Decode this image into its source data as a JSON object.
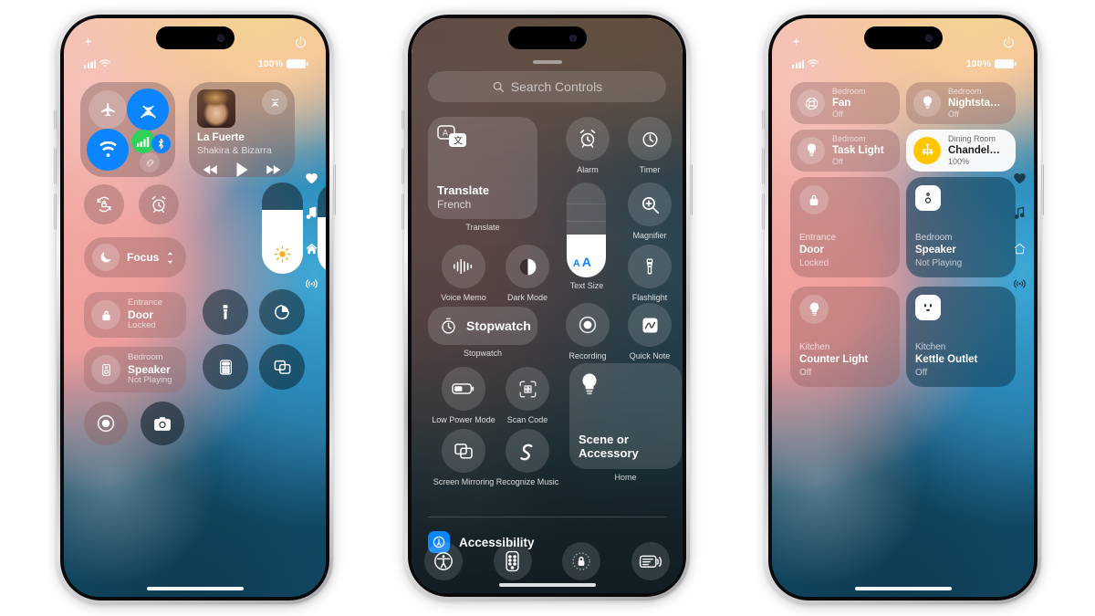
{
  "scene": {
    "title": "iOS 18 Control Center — three iPhone screens",
    "background": "#ffffff",
    "accent_blue": "#0a84ff",
    "accent_green": "#30d158",
    "accent_yellow": "#ffc600"
  },
  "phone1": {
    "status": {
      "battery_percent": "100%",
      "sparkle_icon": "sparkle-icon",
      "power_icon": "power-icon",
      "cellular_icon": "cellular-bars-icon",
      "wifi_icon": "wifi-icon",
      "battery_icon": "battery-icon"
    },
    "connectivity": {
      "airplane": {
        "label": "Airplane Mode",
        "icon": "airplane-icon",
        "state": "off"
      },
      "airdrop": {
        "label": "AirDrop",
        "icon": "airdrop-icon",
        "state": "on"
      },
      "wifi": {
        "label": "Wi-Fi",
        "icon": "wifi-icon",
        "state": "on"
      },
      "cellular": {
        "label": "Cellular Data",
        "icon": "cellular-bars-icon",
        "state": "on"
      },
      "bluetooth": {
        "label": "Bluetooth",
        "icon": "bluetooth-icon",
        "state": "on"
      },
      "hotspot": {
        "label": "Personal Hotspot",
        "icon": "hotspot-link-icon",
        "state": "off"
      }
    },
    "music": {
      "title": "La Fuerte",
      "artist": "Shakira & Bizarra",
      "airplay_icon": "airplay-audio-icon",
      "rewind_icon": "rewind-icon",
      "play_icon": "play-icon",
      "forward_icon": "forward-icon"
    },
    "sliders": {
      "brightness": {
        "label": "Brightness",
        "icon": "sun-icon",
        "value": 70
      },
      "volume": {
        "label": "Volume",
        "icon": "speaker-waves-icon",
        "value": 62
      }
    },
    "controls": {
      "rotation_lock": {
        "label": "Rotation Lock",
        "icon": "rotation-lock-icon"
      },
      "alarm": {
        "label": "Alarm",
        "icon": "alarm-clock-icon"
      },
      "focus": {
        "label": "Focus",
        "icon": "moon-icon",
        "chevron": "chevron-updown-icon"
      },
      "flashlight": {
        "label": "Flashlight",
        "icon": "flashlight-icon"
      },
      "timer": {
        "label": "Timer",
        "icon": "timer-icon"
      },
      "calculator": {
        "label": "Calculator",
        "icon": "calculator-icon"
      },
      "screen_mirroring": {
        "label": "Screen Mirroring",
        "icon": "screen-mirroring-icon"
      },
      "screen_record": {
        "label": "Screen Recording",
        "icon": "record-icon"
      },
      "camera": {
        "label": "Camera",
        "icon": "camera-icon"
      }
    },
    "home_tiles": [
      {
        "room": "Entrance",
        "name": "Door",
        "state": "Locked",
        "icon": "lock-icon"
      },
      {
        "room": "Bedroom",
        "name": "Speaker",
        "state": "Not Playing",
        "icon": "speaker-box-icon"
      }
    ],
    "rail": [
      {
        "name": "favorites-page",
        "icon": "heart-icon"
      },
      {
        "name": "music-page",
        "icon": "music-note-icon"
      },
      {
        "name": "home-page",
        "icon": "home-icon"
      },
      {
        "name": "connectivity-page",
        "icon": "broadcast-icon"
      }
    ]
  },
  "phone2": {
    "search": {
      "placeholder": "Search Controls",
      "icon": "search-icon"
    },
    "grab_handle": "drag-handle",
    "gallery": {
      "translate": {
        "name": "Translate",
        "sub": "French",
        "caption": "Translate",
        "icon": "translate-icon"
      },
      "alarm": {
        "label": "Alarm",
        "icon": "alarm-clock-icon"
      },
      "timer": {
        "label": "Timer",
        "icon": "timer-icon"
      },
      "magnifier": {
        "label": "Magnifier",
        "icon": "magnifier-icon"
      },
      "voice_memo": {
        "label": "Voice Memo",
        "icon": "waveform-icon"
      },
      "dark_mode": {
        "label": "Dark Mode",
        "icon": "dark-mode-icon"
      },
      "text_size": {
        "label": "Text Size",
        "icon": "text-size-icon",
        "value": 45
      },
      "flashlight": {
        "label": "Flashlight",
        "icon": "flashlight-icon"
      },
      "stopwatch": {
        "name": "Stopwatch",
        "caption": "Stopwatch",
        "icon": "stopwatch-icon"
      },
      "recording": {
        "label": "Recording",
        "icon": "record-icon"
      },
      "quick_note": {
        "label": "Quick Note",
        "icon": "quick-note-icon"
      },
      "low_power": {
        "label": "Low Power Mode",
        "icon": "battery-low-icon"
      },
      "scan_code": {
        "label": "Scan Code",
        "icon": "qr-scan-icon"
      },
      "screen_mirroring": {
        "label": "Screen Mirroring",
        "icon": "screen-mirroring-icon"
      },
      "recognize_music": {
        "label": "Recognize Music",
        "icon": "shazam-icon"
      },
      "scene_accessory": {
        "name": "Scene or Accessory",
        "caption": "Home",
        "icon": "lightbulb-icon"
      }
    },
    "accessibility": {
      "label": "Accessibility",
      "icon": "accessibility-badge-icon"
    },
    "dock": [
      {
        "name": "accessibility-shortcut",
        "icon": "accessibility-icon"
      },
      {
        "name": "apple-tv-remote",
        "icon": "remote-icon"
      },
      {
        "name": "guided-access",
        "icon": "guided-access-lock-icon"
      },
      {
        "name": "hearing-control",
        "icon": "hearing-device-icon"
      }
    ]
  },
  "phone3": {
    "status": {
      "battery_percent": "100%",
      "sparkle_icon": "sparkle-icon",
      "power_icon": "power-icon"
    },
    "tiles": [
      {
        "room": "Bedroom",
        "name": "Fan",
        "state": "Off",
        "icon": "fan-icon",
        "on": false,
        "shape": "pill"
      },
      {
        "room": "Bedroom",
        "name": "Nightsta…",
        "state": "Off",
        "icon": "lightbulb-icon",
        "on": false,
        "shape": "pill"
      },
      {
        "room": "Bedroom",
        "name": "Task Light",
        "state": "Off",
        "icon": "lightbulb-icon",
        "on": false,
        "shape": "pill"
      },
      {
        "room": "Dining Room",
        "name": "Chandel…",
        "state": "100%",
        "icon": "chandelier-icon",
        "on": true,
        "shape": "pill"
      },
      {
        "room": "Entrance",
        "name": "Door",
        "state": "Locked",
        "icon": "lock-icon",
        "on": false,
        "shape": "big-warm"
      },
      {
        "room": "Bedroom",
        "name": "Speaker",
        "state": "Not Playing",
        "icon": "speaker-box-icon",
        "on": false,
        "shape": "big-cool"
      },
      {
        "room": "Kitchen",
        "name": "Counter Light",
        "state": "Off",
        "icon": "lightbulb-icon",
        "on": false,
        "shape": "big-warm"
      },
      {
        "room": "Kitchen",
        "name": "Kettle Outlet",
        "state": "Off",
        "icon": "outlet-icon",
        "on": false,
        "shape": "big-cool"
      }
    ],
    "rail": [
      {
        "name": "favorites-page",
        "icon": "heart-icon"
      },
      {
        "name": "music-page",
        "icon": "music-note-icon"
      },
      {
        "name": "home-page",
        "icon": "home-icon"
      },
      {
        "name": "connectivity-page",
        "icon": "broadcast-icon"
      }
    ]
  }
}
